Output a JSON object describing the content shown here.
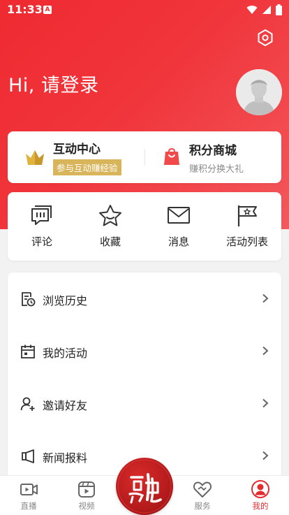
{
  "status_bar": {
    "time": "11:33"
  },
  "header": {
    "greeting": "Hi, 请登录"
  },
  "interaction_center": {
    "title": "互动中心",
    "badge": "参与互动赚经验"
  },
  "points_mall": {
    "title": "积分商城",
    "subtitle": "赚积分换大礼"
  },
  "actions": [
    {
      "label": "评论",
      "icon": "comment-icon"
    },
    {
      "label": "收藏",
      "icon": "star-icon"
    },
    {
      "label": "消息",
      "icon": "mail-icon"
    },
    {
      "label": "活动列表",
      "icon": "flag-icon"
    }
  ],
  "menu": [
    {
      "label": "浏览历史",
      "icon": "history-icon"
    },
    {
      "label": "我的活动",
      "icon": "calendar-icon"
    },
    {
      "label": "邀请好友",
      "icon": "invite-user-icon"
    },
    {
      "label": "新闻报料",
      "icon": "megaphone-icon"
    }
  ],
  "tabs": [
    {
      "label": "直播",
      "icon": "live-icon"
    },
    {
      "label": "视频",
      "icon": "video-icon"
    },
    {
      "label": "服务",
      "icon": "handshake-icon"
    },
    {
      "label": "我的",
      "icon": "profile-icon"
    }
  ],
  "center_logo": {
    "icon": "rong-logo-icon"
  },
  "colors": {
    "brand_red": "#ef2a31",
    "badge_gold": "#d8b55a",
    "active_tab": "#e52b2e"
  }
}
